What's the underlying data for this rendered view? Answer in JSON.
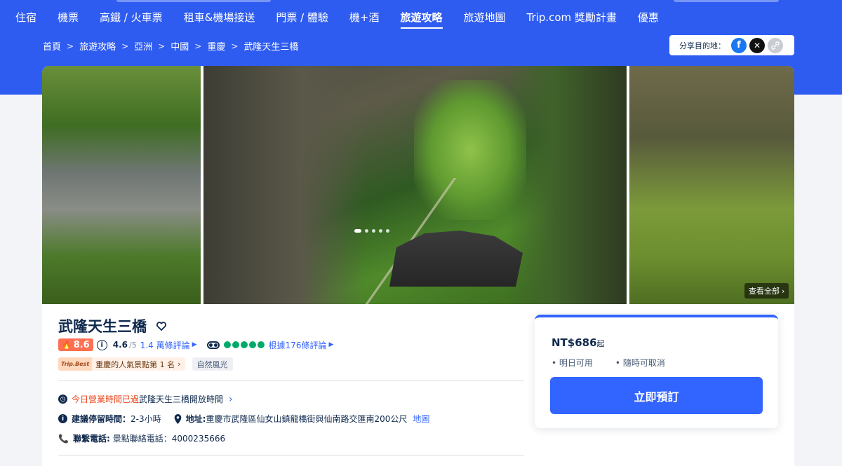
{
  "nav": {
    "items": [
      "住宿",
      "機票",
      "高鐵 / 火車票",
      "租車&機場接送",
      "門票 / 體驗",
      "機+酒",
      "旅遊攻略",
      "旅遊地圖",
      "Trip.com 獎勵計畫",
      "優惠"
    ],
    "active": "旅遊攻略"
  },
  "breadcrumb": [
    "首頁",
    "旅遊攻略",
    "亞洲",
    "中國",
    "重慶",
    "武隆天生三橋"
  ],
  "share": {
    "label": "分享目的地：",
    "icons": [
      "facebook-icon",
      "x-icon",
      "link-icon"
    ]
  },
  "gallery": {
    "view_all": "查看全部",
    "slides": 5,
    "active_slide": 1
  },
  "attraction": {
    "title": "武隆天生三橋",
    "score": "8.6",
    "rating": "4.6",
    "rating_max": "/5",
    "reviews": "1.4 萬條評論",
    "ta_reviews": "根據176條評論",
    "ta_bubbles": 5,
    "rank_logo": "Trip.Best",
    "rank_text": "重慶的人氣景點第 1 名",
    "category": "自然風光"
  },
  "info": {
    "status": "今日營業時間已過",
    "hours_link": "武隆天生三橋開放時間",
    "stay_label": "建議停留時間：",
    "stay_value": "2-3小時",
    "address_label": "地址:",
    "address_value": "重慶市武隆區仙女山鎮龍橋街與仙南路交匯南200公尺",
    "map_link": "地圖",
    "phone_label": "聯繫電話:",
    "phone_value": "景點聯絡電話：4000235666"
  },
  "booking": {
    "price": "NT$686",
    "price_suffix": "起",
    "bullets": [
      "明日可用",
      "隨時可取消"
    ],
    "button": "立即預訂"
  },
  "colors": {
    "brand_blue": "#2f5cf0",
    "button_blue": "#3264ff",
    "score_red": "#ff6f52",
    "status_red": "#eb4a20",
    "ta_green": "#00aa6c"
  }
}
